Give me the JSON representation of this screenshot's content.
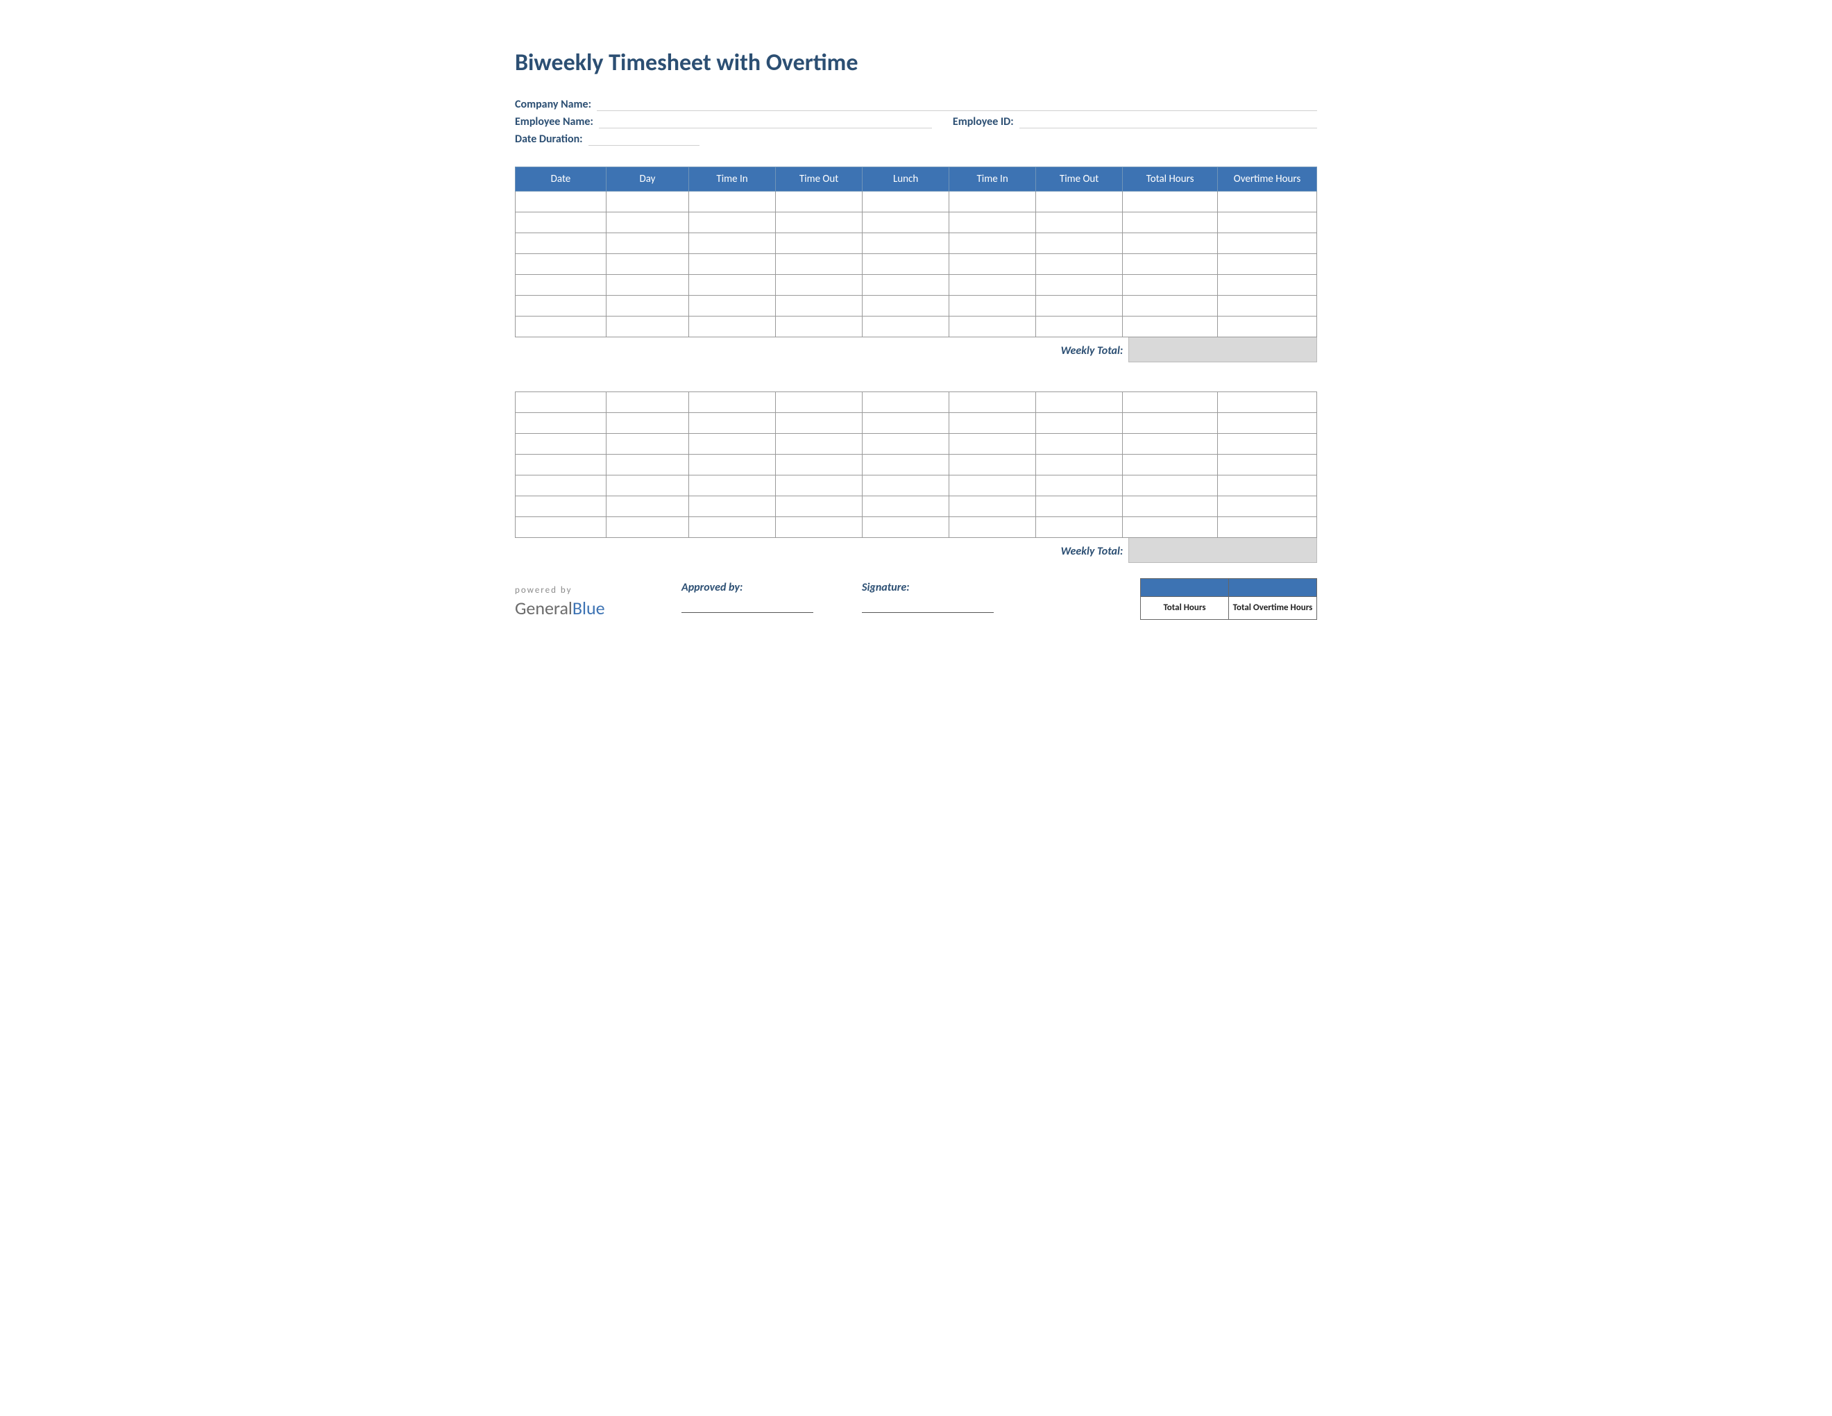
{
  "title": "Biweekly Timesheet with Overtime",
  "info": {
    "company_label": "Company Name:",
    "employee_label": "Employee Name:",
    "employee_id_label": "Employee ID:",
    "duration_label": "Date Duration:",
    "company_value": "",
    "employee_value": "",
    "employee_id_value": "",
    "duration_value": ""
  },
  "headers": {
    "date": "Date",
    "day": "Day",
    "time_in1": "Time In",
    "time_out1": "Time Out",
    "lunch": "Lunch",
    "time_in2": "Time In",
    "time_out2": "Time Out",
    "total_hours": "Total Hours",
    "overtime_hours": "Overtime Hours"
  },
  "weekly_total_label": "Weekly Total:",
  "footer": {
    "powered_by": "powered by",
    "logo_part1": "General",
    "logo_part2": "Blue",
    "approved_label": "Approved by:",
    "signature_label": "Signature:"
  },
  "totals": {
    "total_hours_label": "Total Hours",
    "total_overtime_label": "Total Overtime Hours",
    "total_hours_value": "",
    "total_overtime_value": ""
  },
  "week1_rows": 7,
  "week2_rows": 7
}
